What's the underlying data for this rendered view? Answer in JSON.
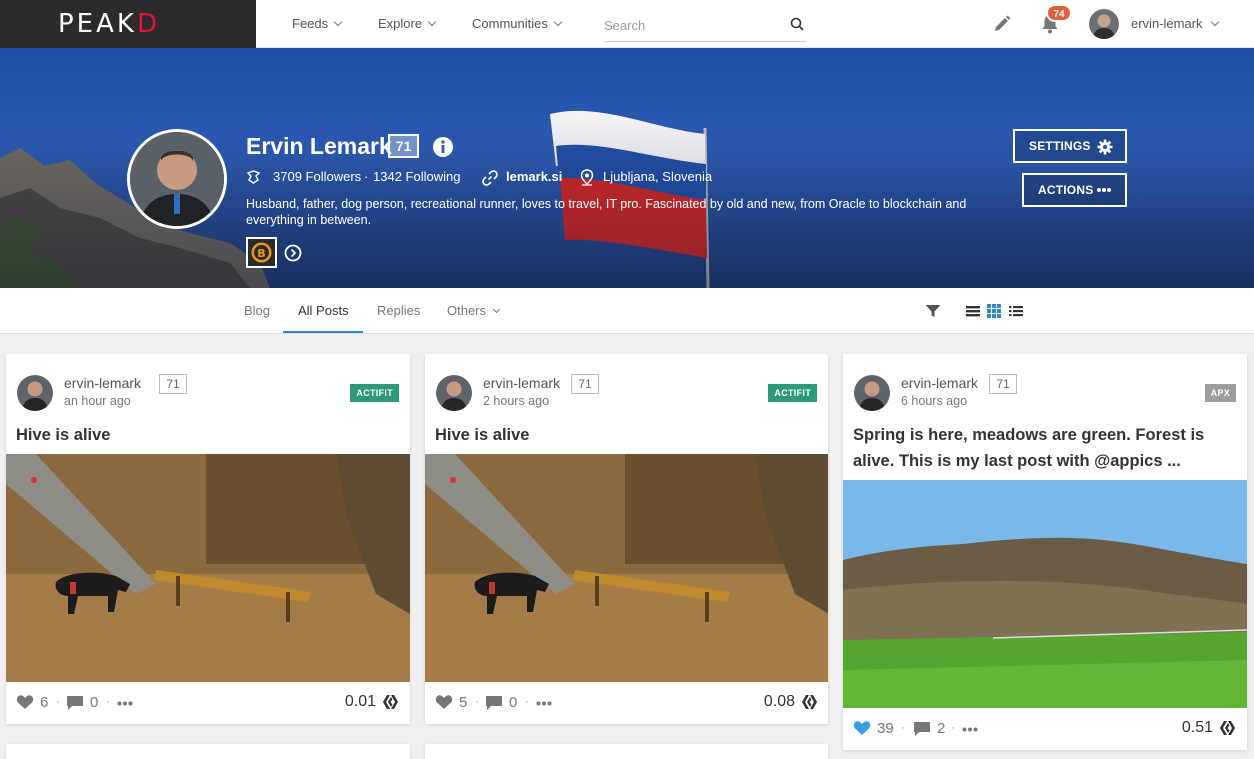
{
  "brand": {
    "name_main": "PEAK",
    "name_accent": "D",
    "accent_color": "#e31337"
  },
  "nav": {
    "items": [
      {
        "label": "Feeds"
      },
      {
        "label": "Explore"
      },
      {
        "label": "Communities"
      }
    ],
    "search_placeholder": "Search",
    "notification_count": "74",
    "username": "ervin-lemark"
  },
  "profile": {
    "name": "Ervin Lemark",
    "reputation": "71",
    "followers": "3709 Followers",
    "separator": "·",
    "following": "1342 Following",
    "website": "lemark.si",
    "location": "Ljubljana, Slovenia",
    "bio": "Husband, father, dog person, recreational runner, loves to travel, IT pro. Fascinated by old and new, from Oracle to blockchain and everything in between.",
    "badge_letter": "B",
    "settings_label": "SETTINGS",
    "actions_label": "ACTIONS"
  },
  "tabs": {
    "items": [
      {
        "label": "Blog"
      },
      {
        "label": "All Posts"
      },
      {
        "label": "Replies"
      },
      {
        "label": "Others"
      }
    ],
    "active": "All Posts"
  },
  "posts": [
    {
      "author": "ervin-lemark",
      "reputation": "71",
      "time": "an hour ago",
      "tag": "ACTIFIT",
      "tag_color": "#2c9a7a",
      "title": "Hive is alive",
      "votes": "6",
      "comments": "0",
      "payout": "0.01",
      "upvoted": false
    },
    {
      "author": "ervin-lemark",
      "reputation": "71",
      "time": "2 hours ago",
      "tag": "ACTIFIT",
      "tag_color": "#2c9a7a",
      "title": "Hive is alive",
      "votes": "5",
      "comments": "0",
      "payout": "0.08",
      "upvoted": false
    },
    {
      "author": "ervin-lemark",
      "reputation": "71",
      "time": "6 hours ago",
      "tag": "APX",
      "tag_color": "#9e9e9e",
      "title": "Spring is here, meadows are green. Forest is alive. This is my last post with @appics ...",
      "votes": "39",
      "comments": "2",
      "payout": "0.51",
      "upvoted": true
    }
  ],
  "colors": {
    "link_blue": "#2f86c8",
    "upvote_blue": "#3a9ee4"
  },
  "icons": [
    "search-icon",
    "pencil-icon",
    "bell-icon",
    "info-icon",
    "followers-icon",
    "link-icon",
    "location-pin-icon",
    "gear-icon",
    "more-dots-icon",
    "filter-icon",
    "list-view-icon",
    "grid-view-icon",
    "compact-view-icon",
    "heart-icon",
    "comment-icon",
    "hive-icon"
  ]
}
